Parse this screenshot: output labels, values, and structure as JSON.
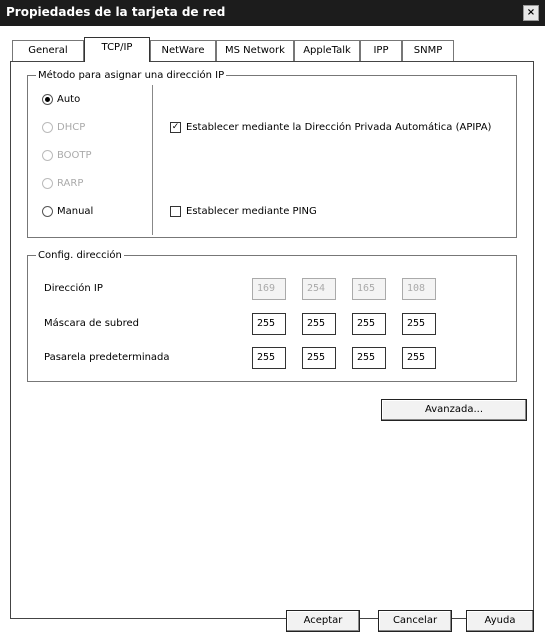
{
  "window": {
    "title": "Propiedades de la tarjeta de red",
    "close_glyph": "×"
  },
  "tabs": [
    {
      "label": "General"
    },
    {
      "label": "TCP/IP"
    },
    {
      "label": "NetWare"
    },
    {
      "label": "MS Network"
    },
    {
      "label": "AppleTalk"
    },
    {
      "label": "IPP"
    },
    {
      "label": "SNMP"
    }
  ],
  "ip_group": {
    "legend": "Método para asignar una dirección IP",
    "radios": [
      {
        "label": "Auto",
        "selected": true,
        "enabled": true
      },
      {
        "label": "DHCP",
        "selected": false,
        "enabled": false
      },
      {
        "label": "BOOTP",
        "selected": false,
        "enabled": false
      },
      {
        "label": "RARP",
        "selected": false,
        "enabled": false
      },
      {
        "label": "Manual",
        "selected": false,
        "enabled": true
      }
    ],
    "check_auto": {
      "label": "Establecer mediante la Dirección Privada Automática (APIPA)",
      "checked": true
    },
    "check_ping": {
      "label": "Establecer mediante PING",
      "checked": false
    }
  },
  "address_group": {
    "legend": "Config. dirección",
    "rows": [
      {
        "label": "Dirección IP",
        "octets": [
          "169",
          "254",
          "165",
          "108"
        ],
        "enabled": false
      },
      {
        "label": "Máscara de subred",
        "octets": [
          "255",
          "255",
          "255",
          "255"
        ],
        "enabled": true
      },
      {
        "label": "Pasarela predeterminada",
        "octets": [
          "255",
          "255",
          "255",
          "255"
        ],
        "enabled": true
      }
    ]
  },
  "buttons": {
    "advanced": "Avanzada...",
    "ok": "Aceptar",
    "cancel": "Cancelar",
    "help": "Ayuda"
  }
}
